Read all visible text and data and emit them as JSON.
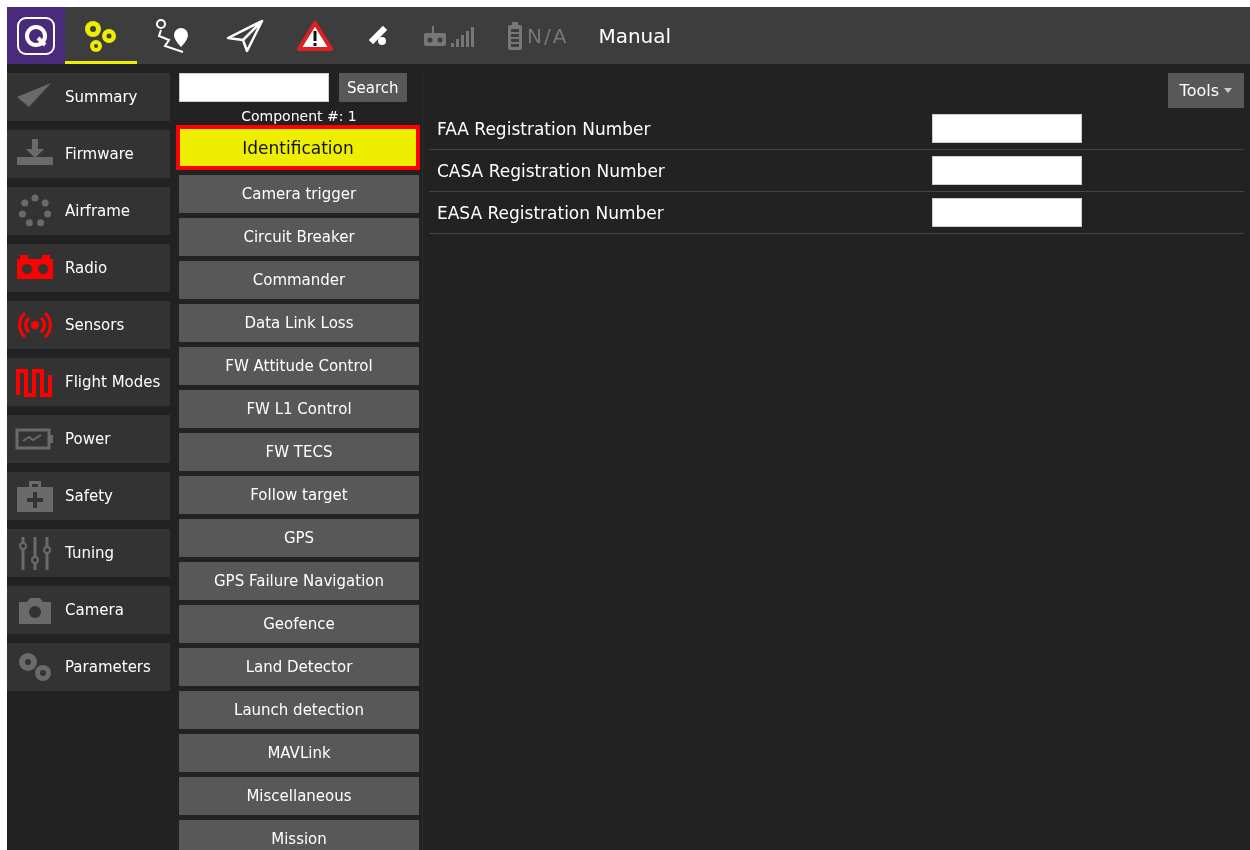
{
  "toolbar": {
    "items": [
      {
        "kind": "setup",
        "selected": true
      },
      {
        "kind": "plan",
        "selected": false
      },
      {
        "kind": "fly",
        "selected": false
      },
      {
        "kind": "warning",
        "selected": false
      },
      {
        "kind": "gps",
        "selected": false
      },
      {
        "kind": "rc",
        "selected": false
      },
      {
        "kind": "battery",
        "selected": false,
        "text": "N/A"
      }
    ],
    "mode": "Manual"
  },
  "sidebar": {
    "items": [
      {
        "label": "Summary",
        "color": "#6a6a6a"
      },
      {
        "label": "Firmware",
        "color": "#6a6a6a"
      },
      {
        "label": "Airframe",
        "color": "#6a6a6a"
      },
      {
        "label": "Radio",
        "color": "#ff0000"
      },
      {
        "label": "Sensors",
        "color": "#ff0000"
      },
      {
        "label": "Flight Modes",
        "color": "#ff0000"
      },
      {
        "label": "Power",
        "color": "#6a6a6a"
      },
      {
        "label": "Safety",
        "color": "#6a6a6a"
      },
      {
        "label": "Tuning",
        "color": "#6a6a6a"
      },
      {
        "label": "Camera",
        "color": "#6a6a6a"
      },
      {
        "label": "Parameters",
        "color": "#6a6a6a"
      }
    ]
  },
  "search": {
    "button": "Search",
    "component": "Component #: 1"
  },
  "groups": [
    {
      "label": "Identification",
      "selected": true
    },
    {
      "label": "Camera trigger",
      "selected": false
    },
    {
      "label": "Circuit Breaker",
      "selected": false
    },
    {
      "label": "Commander",
      "selected": false
    },
    {
      "label": "Data Link Loss",
      "selected": false
    },
    {
      "label": "FW Attitude Control",
      "selected": false
    },
    {
      "label": "FW L1 Control",
      "selected": false
    },
    {
      "label": "FW TECS",
      "selected": false
    },
    {
      "label": "Follow target",
      "selected": false
    },
    {
      "label": "GPS",
      "selected": false
    },
    {
      "label": "GPS Failure Navigation",
      "selected": false
    },
    {
      "label": "Geofence",
      "selected": false
    },
    {
      "label": "Land Detector",
      "selected": false
    },
    {
      "label": "Launch detection",
      "selected": false
    },
    {
      "label": "MAVLink",
      "selected": false
    },
    {
      "label": "Miscellaneous",
      "selected": false
    },
    {
      "label": "Mission",
      "selected": false
    }
  ],
  "tools": "Tools",
  "parameters": [
    {
      "label": "FAA Registration Number"
    },
    {
      "label": "CASA Registration Number"
    },
    {
      "label": "EASA Registration Number"
    }
  ]
}
